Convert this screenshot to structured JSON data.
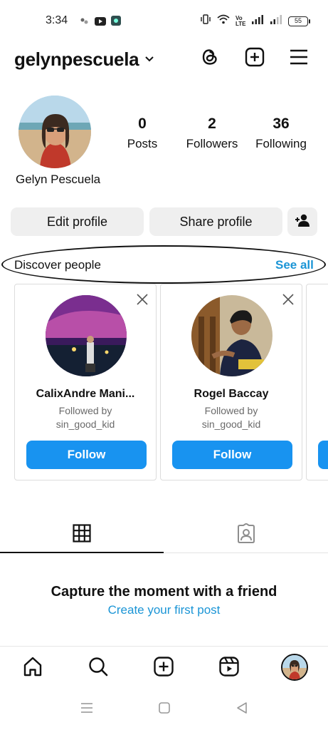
{
  "status_bar": {
    "time": "3:34",
    "battery": "55",
    "network": "Vo LTE"
  },
  "header": {
    "username": "gelynpescuela",
    "icons": [
      "chevron-down-icon",
      "threads-icon",
      "create-post-icon",
      "menu-icon"
    ]
  },
  "profile": {
    "full_name": "Gelyn Pescuela",
    "stats": [
      {
        "value": "0",
        "label": "Posts"
      },
      {
        "value": "2",
        "label": "Followers"
      },
      {
        "value": "36",
        "label": "Following"
      }
    ],
    "edit_button": "Edit profile",
    "share_button": "Share profile"
  },
  "discover": {
    "title": "Discover people",
    "see_all": "See all",
    "cards": [
      {
        "name": "CalixAndre Mani...",
        "sub1": "Followed by",
        "sub2": "sin_good_kid",
        "button": "Follow"
      },
      {
        "name": "Rogel Baccay",
        "sub1": "Followed by",
        "sub2": "sin_good_kid",
        "button": "Follow"
      }
    ]
  },
  "tabs": [
    "grid-icon",
    "tagged-icon"
  ],
  "empty_state": {
    "title": "Capture the moment with a friend",
    "link": "Create your first post"
  },
  "colors": {
    "accent": "#1893f0",
    "link": "#1b95d6",
    "button_bg": "#efefef"
  }
}
